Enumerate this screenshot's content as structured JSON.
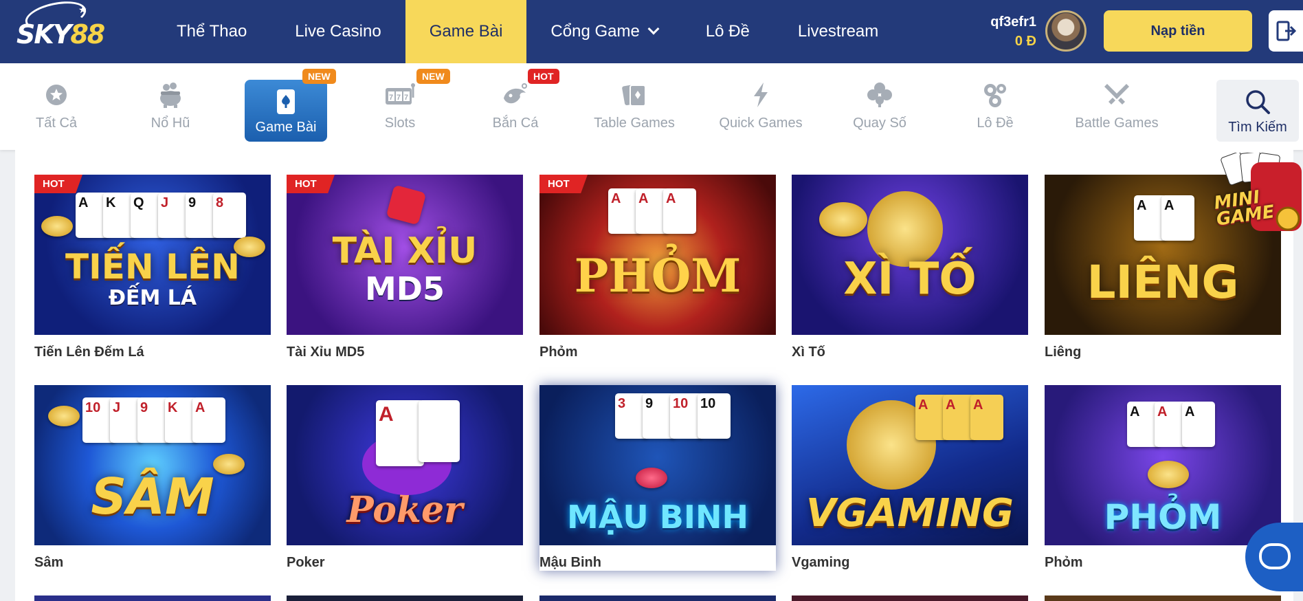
{
  "brand": {
    "logo_text_a": "SKY",
    "logo_text_b": "88"
  },
  "nav": {
    "items": [
      {
        "label": "Thể Thao"
      },
      {
        "label": "Live Casino"
      },
      {
        "label": "Game Bài"
      },
      {
        "label": "Cổng Game"
      },
      {
        "label": "Lô Đề"
      },
      {
        "label": "Livestream"
      }
    ],
    "active": "Game Bài"
  },
  "user": {
    "username": "qf3efr1",
    "balance": "0 Đ"
  },
  "deposit_label": "Nạp tiền",
  "categories": [
    {
      "label": "Tất Cả",
      "icon": "star-icon"
    },
    {
      "label": "Nổ Hũ",
      "icon": "pot-icon"
    },
    {
      "label": "Game Bài",
      "icon": "card-icon",
      "badge": "NEW",
      "active": true
    },
    {
      "label": "Slots",
      "icon": "slot-machine-icon",
      "badge": "NEW"
    },
    {
      "label": "Bắn Cá",
      "icon": "fish-icon",
      "badge": "HOT"
    },
    {
      "label": "Table Games",
      "icon": "table-cards-icon"
    },
    {
      "label": "Quick Games",
      "icon": "lightning-icon"
    },
    {
      "label": "Quay Số",
      "icon": "clover-icon"
    },
    {
      "label": "Lô Đề",
      "icon": "lottery-balls-icon"
    },
    {
      "label": "Battle Games",
      "icon": "crossed-swords-icon"
    },
    {
      "label": "Tìm Kiếm",
      "icon": "search-icon"
    }
  ],
  "games": [
    {
      "title": "Tiến Lên Đếm Lá",
      "art": "TIẾN LÊN",
      "art_sub": "ĐẾM LÁ",
      "tag": "HOT"
    },
    {
      "title": "Tài Xỉu MD5",
      "art": "TÀI XỈU",
      "art_sub": "MD5",
      "tag": "HOT"
    },
    {
      "title": "Phỏm",
      "art": "PHỎM",
      "tag": "HOT"
    },
    {
      "title": "Xì Tố",
      "art": "XÌ TỐ"
    },
    {
      "title": "Liêng",
      "art": "LIÊNG"
    },
    {
      "title": "Sâm",
      "art": "SÂM"
    },
    {
      "title": "Poker",
      "art": "Poker"
    },
    {
      "title": "Mậu Binh",
      "art": "MẬU BINH"
    },
    {
      "title": "Vgaming",
      "art": "VGAMING"
    },
    {
      "title": "Phỏm",
      "art": "PHỎM"
    }
  ],
  "mini_game": {
    "line1": "MINI",
    "line2": "GAME"
  }
}
